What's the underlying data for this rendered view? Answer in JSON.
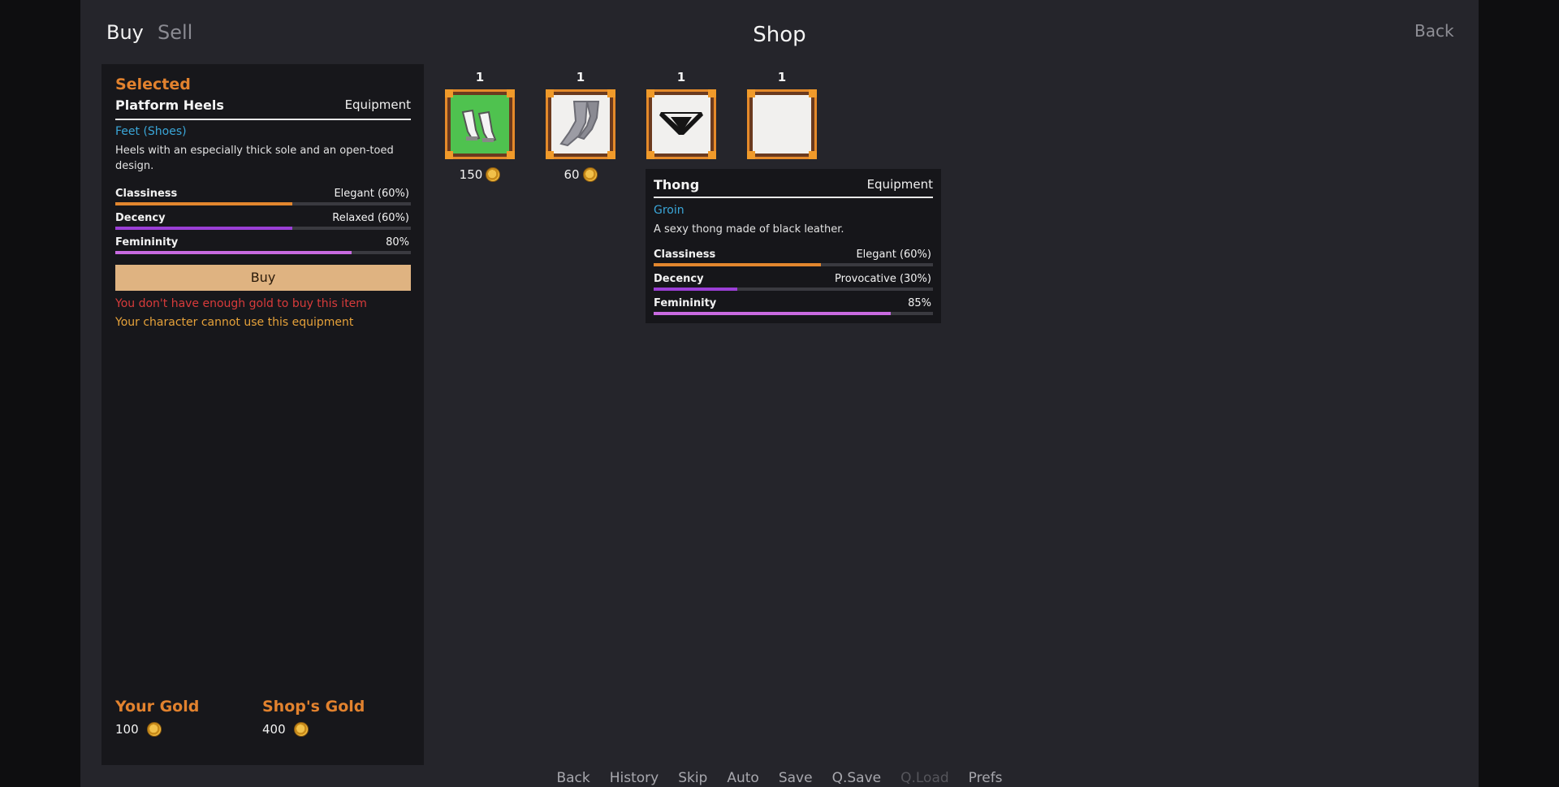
{
  "tabs": {
    "buy": "Buy",
    "sell": "Sell"
  },
  "title": "Shop",
  "back_label": "Back",
  "selected": {
    "heading": "Selected",
    "name": "Platform Heels",
    "type": "Equipment",
    "slot": "Feet (Shoes)",
    "description": "Heels with an especially thick sole and an open-toed design.",
    "stats": [
      {
        "label": "Classiness",
        "value": "Elegant (60%)",
        "level": 0.6,
        "color": "#e2862e"
      },
      {
        "label": "Decency",
        "value": "Relaxed (60%)",
        "level": 0.6,
        "color": "#9b3fd6"
      },
      {
        "label": "Femininity",
        "value": "80%",
        "level": 0.8,
        "color": "#c86ae0"
      }
    ],
    "buy_label": "Buy",
    "warning_gold": "You don't have enough gold to buy this item",
    "warning_equipment": "Your character cannot use this equipment"
  },
  "gold": {
    "yours_label": "Your Gold",
    "yours_value": "100",
    "shop_label": "Shop's Gold",
    "shop_value": "400"
  },
  "items": [
    {
      "qty": "1",
      "price": "150",
      "icon": "heels-icon",
      "selected": true
    },
    {
      "qty": "1",
      "price": "60",
      "icon": "stockings-icon",
      "selected": false
    },
    {
      "qty": "1",
      "price": "",
      "icon": "thong-icon",
      "selected": false
    },
    {
      "qty": "1",
      "price": "",
      "icon": "empty-item-icon",
      "selected": false
    }
  ],
  "tooltip": {
    "name": "Thong",
    "type": "Equipment",
    "slot": "Groin",
    "description": "A sexy thong made of black leather.",
    "stats": [
      {
        "label": "Classiness",
        "value": "Elegant (60%)",
        "level": 0.6,
        "color": "#e2862e"
      },
      {
        "label": "Decency",
        "value": "Provocative (30%)",
        "level": 0.3,
        "color": "#9b3fd6"
      },
      {
        "label": "Femininity",
        "value": "85%",
        "level": 0.85,
        "color": "#c86ae0"
      }
    ]
  },
  "quick_menu": [
    {
      "label": "Back",
      "enabled": true
    },
    {
      "label": "History",
      "enabled": true
    },
    {
      "label": "Skip",
      "enabled": true
    },
    {
      "label": "Auto",
      "enabled": true
    },
    {
      "label": "Save",
      "enabled": true
    },
    {
      "label": "Q.Save",
      "enabled": true
    },
    {
      "label": "Q.Load",
      "enabled": false
    },
    {
      "label": "Prefs",
      "enabled": true
    }
  ]
}
